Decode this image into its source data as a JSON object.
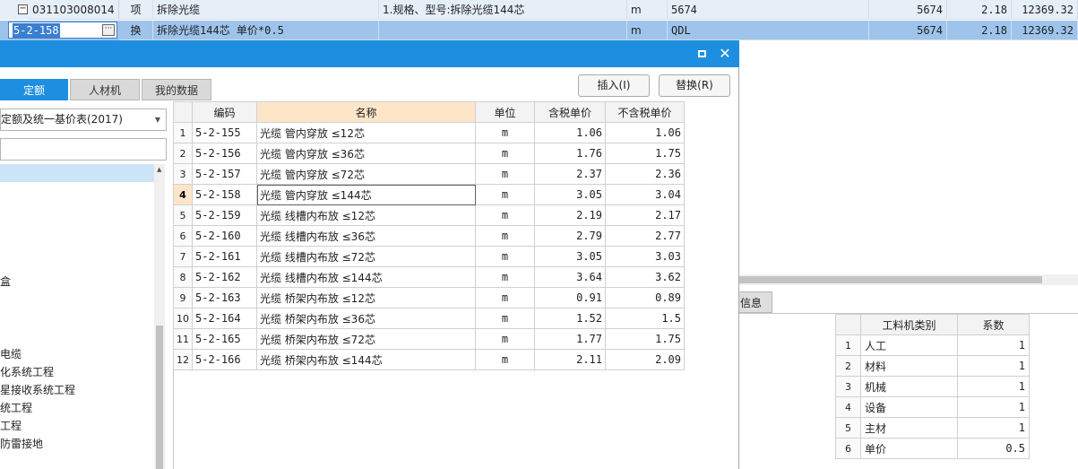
{
  "background_rows": [
    {
      "code": "031103008014",
      "type": "项",
      "name": "拆除光缆",
      "feature": "1.规格、型号:拆除光缆144芯",
      "unit": "m",
      "qty_expr": "5674",
      "qty": "5674",
      "price": "2.18",
      "total": "12369.32"
    },
    {
      "code": "5-2-158",
      "type": "换",
      "name": "拆除光缆144芯  单价*0.5",
      "feature": "",
      "unit": "m",
      "qty_expr": "QDL",
      "qty": "5674",
      "price": "2.18",
      "total": "12369.32"
    }
  ],
  "dialog": {
    "tabs": [
      "定额",
      "人材机",
      "我的数据"
    ],
    "buttons": {
      "insert": "插入(I)",
      "replace": "替换(R)"
    },
    "library": "定额及统一基价表(2017)",
    "tree_items": [
      "盒",
      "电缆",
      "化系统工程",
      "星接收系统工程",
      "统工程",
      "工程",
      "防雷接地"
    ]
  },
  "quota_table": {
    "headers": [
      "编码",
      "名称",
      "单位",
      "含税单价",
      "不含税单价"
    ],
    "rows": [
      {
        "no": "1",
        "code": "5-2-155",
        "name": "光缆 管内穿放 ≤12芯",
        "unit": "m",
        "tax_price": "1.06",
        "notax_price": "1.06"
      },
      {
        "no": "2",
        "code": "5-2-156",
        "name": "光缆 管内穿放 ≤36芯",
        "unit": "m",
        "tax_price": "1.76",
        "notax_price": "1.75"
      },
      {
        "no": "3",
        "code": "5-2-157",
        "name": "光缆 管内穿放 ≤72芯",
        "unit": "m",
        "tax_price": "2.37",
        "notax_price": "2.36"
      },
      {
        "no": "4",
        "code": "5-2-158",
        "name": "光缆 管内穿放 ≤144芯",
        "unit": "m",
        "tax_price": "3.05",
        "notax_price": "3.04"
      },
      {
        "no": "5",
        "code": "5-2-159",
        "name": "光缆 线槽内布放 ≤12芯",
        "unit": "m",
        "tax_price": "2.19",
        "notax_price": "2.17"
      },
      {
        "no": "6",
        "code": "5-2-160",
        "name": "光缆 线槽内布放 ≤36芯",
        "unit": "m",
        "tax_price": "2.79",
        "notax_price": "2.77"
      },
      {
        "no": "7",
        "code": "5-2-161",
        "name": "光缆 线槽内布放 ≤72芯",
        "unit": "m",
        "tax_price": "3.05",
        "notax_price": "3.03"
      },
      {
        "no": "8",
        "code": "5-2-162",
        "name": "光缆 线槽内布放 ≤144芯",
        "unit": "m",
        "tax_price": "3.64",
        "notax_price": "3.62"
      },
      {
        "no": "9",
        "code": "5-2-163",
        "name": "光缆 桥架内布放 ≤12芯",
        "unit": "m",
        "tax_price": "0.91",
        "notax_price": "0.89"
      },
      {
        "no": "10",
        "code": "5-2-164",
        "name": "光缆 桥架内布放 ≤36芯",
        "unit": "m",
        "tax_price": "1.52",
        "notax_price": "1.5"
      },
      {
        "no": "11",
        "code": "5-2-165",
        "name": "光缆 桥架内布放 ≤72芯",
        "unit": "m",
        "tax_price": "1.77",
        "notax_price": "1.75"
      },
      {
        "no": "12",
        "code": "5-2-166",
        "name": "光缆 桥架内布放 ≤144芯",
        "unit": "m",
        "tax_price": "2.11",
        "notax_price": "2.09"
      }
    ]
  },
  "info_tab": "信息",
  "coef_table": {
    "headers": [
      "工料机类别",
      "系数"
    ],
    "rows": [
      {
        "no": "1",
        "category": "人工",
        "coef": "1"
      },
      {
        "no": "2",
        "category": "材料",
        "coef": "1"
      },
      {
        "no": "3",
        "category": "机械",
        "coef": "1"
      },
      {
        "no": "4",
        "category": "设备",
        "coef": "1"
      },
      {
        "no": "5",
        "category": "主材",
        "coef": "1"
      },
      {
        "no": "6",
        "category": "单价",
        "coef": "0.5"
      }
    ]
  }
}
